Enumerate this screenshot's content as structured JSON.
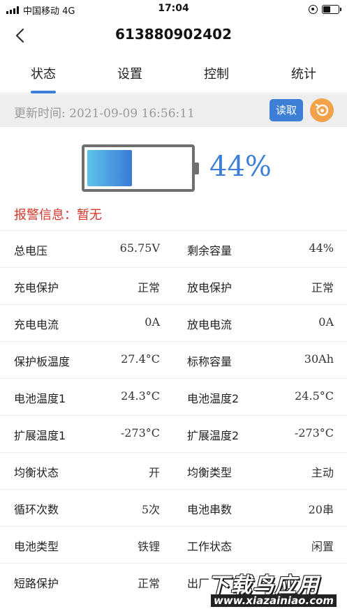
{
  "status_bar": {
    "carrier": "中国移动  4G",
    "time": "17:04"
  },
  "nav": {
    "title": "613880902402"
  },
  "tabs": [
    {
      "label": "状态",
      "active": true
    },
    {
      "label": "设置",
      "active": false
    },
    {
      "label": "控制",
      "active": false
    },
    {
      "label": "统计",
      "active": false
    }
  ],
  "update": {
    "label": "更新时间: 2021-09-09 16:56:11",
    "read_button": "读取"
  },
  "battery": {
    "percent_text": "44%",
    "level_fraction": 0.44,
    "gradient_start": "#5fc3ea",
    "gradient_end": "#3b7ad6"
  },
  "alarm": {
    "text": "报警信息：暂无",
    "color": "#d6362a"
  },
  "accent_color": "#3d7fd6",
  "refresh_color": "#f2a24a",
  "rows": [
    {
      "l1": "总电压",
      "v1": "65.75V",
      "l2": "剩余容量",
      "v2": "44%"
    },
    {
      "l1": "充电保护",
      "v1": "正常",
      "l2": "放电保护",
      "v2": "正常"
    },
    {
      "l1": "充电电流",
      "v1": "0A",
      "l2": "放电电流",
      "v2": "0A"
    },
    {
      "l1": "保护板温度",
      "v1": "27.4°C",
      "l2": "标称容量",
      "v2": "30Ah"
    },
    {
      "l1": "电池温度1",
      "v1": "24.3°C",
      "l2": "电池温度2",
      "v2": "24.5°C"
    },
    {
      "l1": "扩展温度1",
      "v1": "-273°C",
      "l2": "扩展温度2",
      "v2": "-273°C"
    },
    {
      "l1": "均衡状态",
      "v1": "开",
      "l2": "均衡类型",
      "v2": "主动"
    },
    {
      "l1": "循环次数",
      "v1": "5次",
      "l2": "电池串数",
      "v2": "20串"
    },
    {
      "l1": "电池类型",
      "v1": "铁锂",
      "l2": "工作状态",
      "v2": "闲置"
    },
    {
      "l1": "短路保护",
      "v1": "正常",
      "l2": "出厂",
      "v2": ""
    }
  ],
  "watermark": {
    "top": "下载鸟应用",
    "bottom": "www.xiazainiao.com"
  }
}
